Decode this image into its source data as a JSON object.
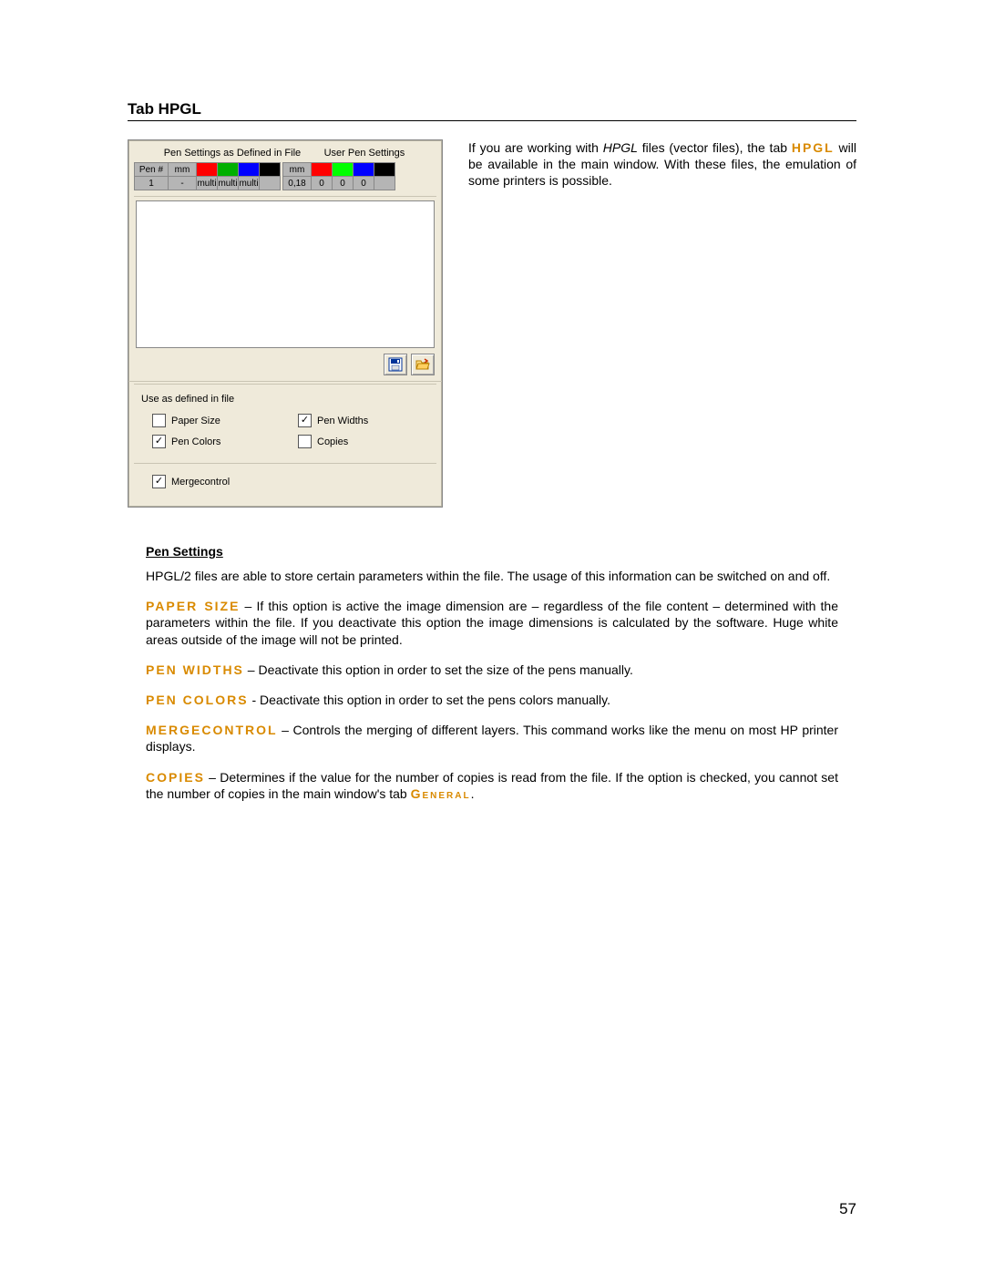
{
  "title": "Tab HPGL",
  "page_number": "57",
  "dialog": {
    "file_label": "Pen Settings as Defined in File",
    "user_label": "User Pen Settings",
    "file_table": {
      "headers": [
        "Pen #",
        "mm",
        "",
        "",
        "",
        ""
      ],
      "row": {
        "pen": "1",
        "mm": "-",
        "c1": "multi",
        "c2": "multi",
        "c3": "multi"
      },
      "colors": [
        "#ff0000",
        "#00b000",
        "#0000ff",
        "#000000"
      ]
    },
    "user_table": {
      "headers": [
        "mm",
        "",
        "",
        "",
        ""
      ],
      "row": {
        "mm": "0,18",
        "v1": "0",
        "v2": "0",
        "v3": "0"
      },
      "colors": [
        "#ff0000",
        "#00ff00",
        "#0000ff",
        "#000000"
      ]
    },
    "group_title": "Use as defined in file",
    "checks": {
      "paper_size": "Paper Size",
      "pen_widths": "Pen Widths",
      "pen_colors": "Pen Colors",
      "copies": "Copies",
      "mergecontrol": "Mergecontrol"
    },
    "checked": {
      "paper_size": false,
      "pen_widths": true,
      "pen_colors": true,
      "copies": false,
      "mergecontrol": true
    }
  },
  "side_text": {
    "p1a": "If you are working with ",
    "p1_ital": "HPGL",
    "p1b": " files (vector files), the tab ",
    "p1_hl": "HPGL",
    "p1c": " will be available in the main window. With these files, the emulation of some printers is possible."
  },
  "sub_heading": "Pen Settings",
  "paras": {
    "p2": "HPGL/2 files are able to store certain parameters within the file. The usage of this information can be switched on and off.",
    "p3_hl": "PAPER SIZE",
    "p3": " – If this option is active the image dimension are – regardless of the file content – determined with the parameters within the file. If you deactivate this option the image dimensions is calculated by the software. Huge white areas outside of the image will not be printed.",
    "p4_hl": "PEN WIDTHS",
    "p4": " – Deactivate this option in order to set the size of the pens manually.",
    "p5_hl": "PEN COLORS",
    "p5": " - Deactivate this option in order to set the pens colors manually.",
    "p6_hl": "MERGECONTROL",
    "p6": " – Controls the merging of different layers. This command works like the menu on most HP printer displays.",
    "p7_hl": "COPIES",
    "p7a": " – Determines if the value for the number of copies is read from the file. If the option is checked, you cannot set the number of copies in the main window's tab ",
    "p7_hl2": "General",
    "p7b": "."
  }
}
